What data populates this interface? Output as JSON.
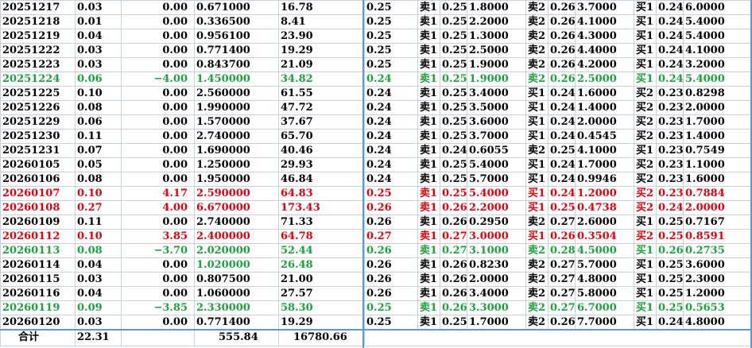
{
  "rows": [
    {
      "date": "20251217",
      "vol": "0.03",
      "chg": "0.00",
      "price": "0.671000",
      "amt": "16.78",
      "cur": "0.25",
      "s1l": "卖1",
      "s1p": "0.25",
      "s1v": "1.8000",
      "s2l": "卖2",
      "s2p": "0.26",
      "s2v": "3.7000",
      "b1l": "买1",
      "b1p": "0.24",
      "b1v": "6.0000",
      "color": "black"
    },
    {
      "date": "20251218",
      "vol": "0.01",
      "chg": "0.00",
      "price": "0.336500",
      "amt": "8.41",
      "cur": "0.25",
      "s1l": "卖1",
      "s1p": "0.25",
      "s1v": "2.2000",
      "s2l": "卖2",
      "s2p": "0.26",
      "s2v": "4.1000",
      "b1l": "买1",
      "b1p": "0.24",
      "b1v": "5.4000",
      "color": "black"
    },
    {
      "date": "20251219",
      "vol": "0.04",
      "chg": "0.00",
      "price": "0.956100",
      "amt": "23.90",
      "cur": "0.25",
      "s1l": "卖1",
      "s1p": "0.25",
      "s1v": "1.3000",
      "s2l": "卖2",
      "s2p": "0.26",
      "s2v": "4.3000",
      "b1l": "买1",
      "b1p": "0.24",
      "b1v": "5.4000",
      "color": "black"
    },
    {
      "date": "20251222",
      "vol": "0.03",
      "chg": "0.00",
      "price": "0.771400",
      "amt": "19.29",
      "cur": "0.25",
      "s1l": "卖1",
      "s1p": "0.25",
      "s1v": "2.5000",
      "s2l": "卖2",
      "s2p": "0.26",
      "s2v": "4.4000",
      "b1l": "买1",
      "b1p": "0.24",
      "b1v": "4.1000",
      "color": "black"
    },
    {
      "date": "20251223",
      "vol": "0.03",
      "chg": "0.00",
      "price": "0.843700",
      "amt": "21.09",
      "cur": "0.25",
      "s1l": "卖1",
      "s1p": "0.25",
      "s1v": "1.9000",
      "s2l": "卖2",
      "s2p": "0.26",
      "s2v": "4.2000",
      "b1l": "买1",
      "b1p": "0.24",
      "b1v": "3.2000",
      "color": "black"
    },
    {
      "date": "20251224",
      "vol": "0.06",
      "chg": "−4.00",
      "price": "1.450000",
      "amt": "34.82",
      "cur": "0.24",
      "s1l": "卖1",
      "s1p": "0.25",
      "s1v": "1.9000",
      "s2l": "卖2",
      "s2p": "0.26",
      "s2v": "2.5000",
      "b1l": "买1",
      "b1p": "0.24",
      "b1v": "5.4000",
      "color": "green"
    },
    {
      "date": "20251225",
      "vol": "0.10",
      "chg": "0.00",
      "price": "2.560000",
      "amt": "61.55",
      "cur": "0.24",
      "s1l": "卖1",
      "s1p": "0.25",
      "s1v": "3.4000",
      "s2l": "买1",
      "s2p": "0.24",
      "s2v": "1.6000",
      "b1l": "买2",
      "b1p": "0.23",
      "b1v": "0.8298",
      "color": "black"
    },
    {
      "date": "20251226",
      "vol": "0.08",
      "chg": "0.00",
      "price": "1.990000",
      "amt": "47.72",
      "cur": "0.24",
      "s1l": "卖1",
      "s1p": "0.25",
      "s1v": "3.5000",
      "s2l": "买1",
      "s2p": "0.24",
      "s2v": "1.4000",
      "b1l": "买2",
      "b1p": "0.23",
      "b1v": "2.0000",
      "color": "black"
    },
    {
      "date": "20251229",
      "vol": "0.06",
      "chg": "0.00",
      "price": "1.570000",
      "amt": "37.67",
      "cur": "0.24",
      "s1l": "卖1",
      "s1p": "0.25",
      "s1v": "3.6000",
      "s2l": "买1",
      "s2p": "0.24",
      "s2v": "2.0000",
      "b1l": "买2",
      "b1p": "0.23",
      "b1v": "1.7000",
      "color": "black"
    },
    {
      "date": "20251230",
      "vol": "0.11",
      "chg": "0.00",
      "price": "2.740000",
      "amt": "65.70",
      "cur": "0.24",
      "s1l": "卖1",
      "s1p": "0.25",
      "s1v": "3.7000",
      "s2l": "买1",
      "s2p": "0.24",
      "s2v": "0.4545",
      "b1l": "买2",
      "b1p": "0.23",
      "b1v": "1.4000",
      "color": "black"
    },
    {
      "date": "20251231",
      "vol": "0.07",
      "chg": "0.00",
      "price": "1.690000",
      "amt": "40.46",
      "cur": "0.24",
      "s1l": "卖1",
      "s1p": "0.24",
      "s1v": "0.6055",
      "s2l": "卖2",
      "s2p": "0.25",
      "s2v": "4.1000",
      "b1l": "买1",
      "b1p": "0.23",
      "b1v": "0.7549",
      "color": "black"
    },
    {
      "date": "20260105",
      "vol": "0.05",
      "chg": "0.00",
      "price": "1.250000",
      "amt": "29.93",
      "cur": "0.24",
      "s1l": "卖1",
      "s1p": "0.25",
      "s1v": "5.4000",
      "s2l": "买1",
      "s2p": "0.24",
      "s2v": "1.7000",
      "b1l": "买2",
      "b1p": "0.23",
      "b1v": "1.1000",
      "color": "black"
    },
    {
      "date": "20260106",
      "vol": "0.08",
      "chg": "0.00",
      "price": "1.950000",
      "amt": "46.84",
      "cur": "0.24",
      "s1l": "卖1",
      "s1p": "0.25",
      "s1v": "5.7000",
      "s2l": "买1",
      "s2p": "0.24",
      "s2v": "0.9946",
      "b1l": "买2",
      "b1p": "0.23",
      "b1v": "1.6000",
      "color": "black"
    },
    {
      "date": "20260107",
      "vol": "0.10",
      "chg": "4.17",
      "price": "2.590000",
      "amt": "64.83",
      "cur": "0.25",
      "s1l": "卖1",
      "s1p": "0.25",
      "s1v": "5.4000",
      "s2l": "买1",
      "s2p": "0.24",
      "s2v": "1.2000",
      "b1l": "买2",
      "b1p": "0.23",
      "b1v": "0.7884",
      "color": "red"
    },
    {
      "date": "20260108",
      "vol": "0.27",
      "chg": "4.00",
      "price": "6.670000",
      "amt": "173.43",
      "cur": "0.26",
      "s1l": "卖1",
      "s1p": "0.26",
      "s1v": "2.2000",
      "s2l": "买1",
      "s2p": "0.25",
      "s2v": "0.4738",
      "b1l": "买2",
      "b1p": "0.24",
      "b1v": "2.0000",
      "color": "red"
    },
    {
      "date": "20260109",
      "vol": "0.11",
      "chg": "0.00",
      "price": "2.740000",
      "amt": "71.33",
      "cur": "0.26",
      "s1l": "卖1",
      "s1p": "0.26",
      "s1v": "0.2950",
      "s2l": "卖2",
      "s2p": "0.27",
      "s2v": "2.6000",
      "b1l": "买1",
      "b1p": "0.25",
      "b1v": "0.7167",
      "color": "black"
    },
    {
      "date": "20260112",
      "vol": "0.10",
      "chg": "3.85",
      "price": "2.400000",
      "amt": "64.78",
      "cur": "0.27",
      "s1l": "卖1",
      "s1p": "0.27",
      "s1v": "3.0000",
      "s2l": "买1",
      "s2p": "0.26",
      "s2v": "0.3504",
      "b1l": "买2",
      "b1p": "0.25",
      "b1v": "0.8591",
      "color": "red"
    },
    {
      "date": "20260113",
      "vol": "0.08",
      "chg": "−3.70",
      "price": "2.020000",
      "amt": "52.44",
      "cur": "0.26",
      "s1l": "卖1",
      "s1p": "0.27",
      "s1v": "3.1000",
      "s2l": "卖2",
      "s2p": "0.28",
      "s2v": "4.5000",
      "b1l": "买1",
      "b1p": "0.26",
      "b1v": "0.2735",
      "color": "green"
    },
    {
      "date": "20260114",
      "vol": "0.04",
      "chg": "0.00",
      "price": "1.020000",
      "amt": "26.48",
      "cur": "0.26",
      "s1l": "卖1",
      "s1p": "0.26",
      "s1v": "0.8230",
      "s2l": "卖2",
      "s2p": "0.27",
      "s2v": "5.7000",
      "b1l": "买1",
      "b1p": "0.25",
      "b1v": "3.6000",
      "color": "mixed"
    },
    {
      "date": "20260115",
      "vol": "0.03",
      "chg": "0.00",
      "price": "0.807500",
      "amt": "21.00",
      "cur": "0.26",
      "s1l": "卖1",
      "s1p": "0.26",
      "s1v": "2.0000",
      "s2l": "卖2",
      "s2p": "0.27",
      "s2v": "4.8000",
      "b1l": "买1",
      "b1p": "0.25",
      "b1v": "2.3000",
      "color": "black"
    },
    {
      "date": "20260116",
      "vol": "0.04",
      "chg": "0.00",
      "price": "1.060000",
      "amt": "27.57",
      "cur": "0.26",
      "s1l": "卖1",
      "s1p": "0.26",
      "s1v": "3.4000",
      "s2l": "卖2",
      "s2p": "0.27",
      "s2v": "5.8000",
      "b1l": "买1",
      "b1p": "0.25",
      "b1v": "1.2000",
      "color": "black"
    },
    {
      "date": "20260119",
      "vol": "0.09",
      "chg": "−3.85",
      "price": "2.330000",
      "amt": "58.30",
      "cur": "0.25",
      "s1l": "卖1",
      "s1p": "0.26",
      "s1v": "3.3000",
      "s2l": "卖2",
      "s2p": "0.27",
      "s2v": "6.7000",
      "b1l": "买1",
      "b1p": "0.25",
      "b1v": "0.5653",
      "color": "green"
    },
    {
      "date": "20260120",
      "vol": "0.03",
      "chg": "0.00",
      "price": "0.771400",
      "amt": "19.29",
      "cur": "0.25",
      "s1l": "卖1",
      "s1p": "0.25",
      "s1v": "1.7000",
      "s2l": "卖2",
      "s2p": "0.26",
      "s2v": "7.7000",
      "b1l": "买1",
      "b1p": "0.24",
      "b1v": "4.8000",
      "color": "black"
    }
  ],
  "total": {
    "label": "合计",
    "vol": "22.31",
    "price": "555.84",
    "amt": "16780.66"
  },
  "colors": {
    "red": "#e8000f",
    "green": "#1aa53b",
    "grid": "#c8d2dc",
    "separator": "#5b9bd5"
  }
}
